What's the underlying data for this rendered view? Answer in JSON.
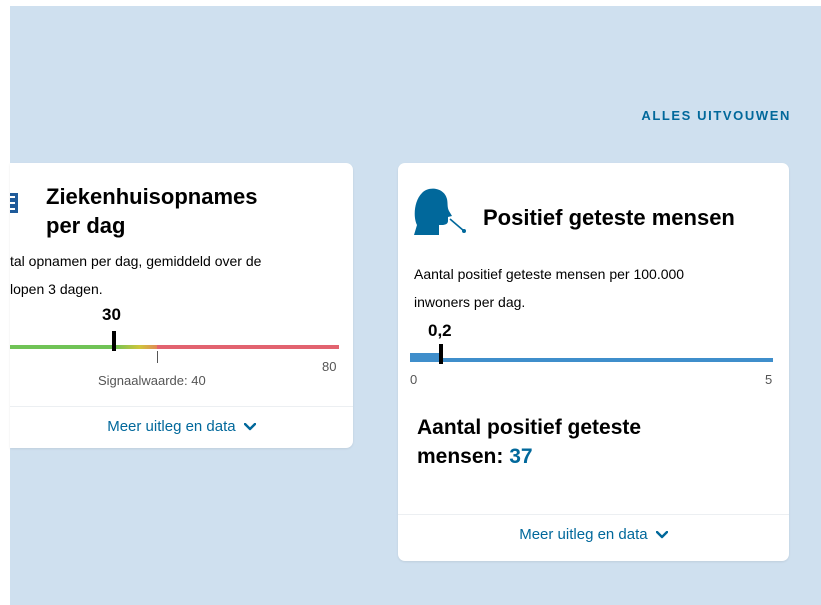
{
  "header": {
    "expand_all_label": "ALLES UITVOUWEN"
  },
  "cards": [
    {
      "title_line1": "Ziekenhuisopnames",
      "title_line2": "per dag",
      "description_line1": "tal opnamen per dag, gemiddeld over de",
      "description_line2": "lopen 3 dagen.",
      "value": "30",
      "axis_max_label": "80",
      "signal_label": "Signaalwaarde: 40",
      "more_link_label": "Meer uitleg en data",
      "colors": {
        "green": "#70c356",
        "yellow": "#cfc53b",
        "red": "#e2636f"
      }
    },
    {
      "title": "Positief geteste mensen",
      "description_line1": "Aantal positief geteste mensen per 100.000",
      "description_line2": "inwoners per dag.",
      "value": "0,2",
      "axis_min_label": "0",
      "axis_max_label": "5",
      "footer_label": "Aantal positief geteste",
      "footer_label_line2": "mensen:",
      "footer_value": "37",
      "more_link_label": "Meer uitleg en data",
      "colors": {
        "bar": "#3f8ecb",
        "icon": "#01689b"
      }
    }
  ],
  "icons": [
    "hospital-icon",
    "person-swab-test-icon",
    "chevron-down-icon"
  ]
}
